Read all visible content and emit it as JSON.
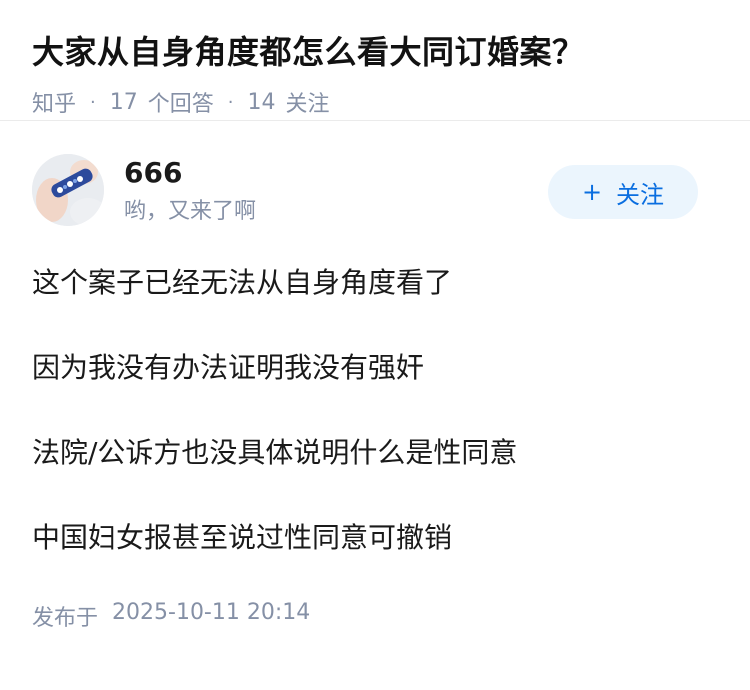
{
  "question": {
    "title": "大家从自身角度都怎么看大同订婚案？",
    "source": "知乎",
    "answer_count": "17",
    "answer_label": "个回答",
    "follower_count": "14",
    "follower_label": "关注"
  },
  "answer": {
    "author": {
      "name": "666",
      "bio": "哟，又来了啊",
      "avatar_icon": "avatar-photo-icon"
    },
    "follow_button": {
      "plus": "+",
      "label": "关注"
    },
    "paragraphs": [
      "这个案子已经无法从自身角度看了",
      "因为我没有办法证明我没有强奸",
      "法院/公诉方也没具体说明什么是性同意",
      "中国妇女报甚至说过性同意可撤销"
    ],
    "publish_label": "发布于",
    "publish_time": "2025-10-11 20:14"
  },
  "colors": {
    "meta_gray": "#8590a6",
    "follow_bg": "#ebf5fd",
    "follow_text": "#0a6ee0"
  }
}
